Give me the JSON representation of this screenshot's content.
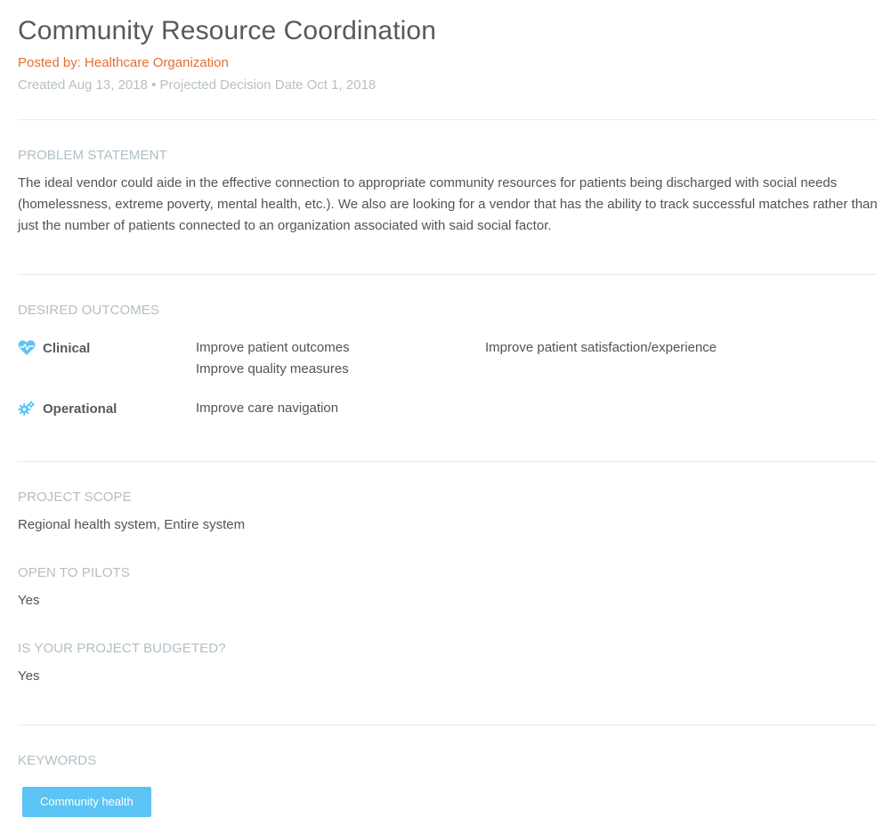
{
  "header": {
    "title": "Community Resource Coordination",
    "posted_by_prefix": "Posted by: ",
    "posted_by_org": "Healthcare Organization",
    "meta": "Created Aug 13, 2018 • Projected Decision Date Oct 1, 2018"
  },
  "problem_statement": {
    "label": "PROBLEM STATEMENT",
    "text": "The ideal vendor could aide in the effective connection to appropriate community resources for patients being discharged with social needs (homelessness, extreme poverty, mental health, etc.). We also are looking for a vendor that has the ability to track successful matches rather than just the number of patients connected to an organization associated with said social factor."
  },
  "desired_outcomes": {
    "label": "DESIRED OUTCOMES",
    "categories": [
      {
        "name": "Clinical",
        "icon": "heart-pulse-icon",
        "items": [
          "Improve patient outcomes",
          "Improve quality measures",
          "Improve patient satisfaction/experience"
        ]
      },
      {
        "name": "Operational",
        "icon": "gears-icon",
        "items": [
          "Improve care navigation"
        ]
      }
    ]
  },
  "project_scope": {
    "label": "PROJECT SCOPE",
    "value": "Regional health system, Entire system"
  },
  "open_to_pilots": {
    "label": "OPEN TO PILOTS",
    "value": "Yes"
  },
  "budgeted": {
    "label": "IS YOUR PROJECT BUDGETED?",
    "value": "Yes"
  },
  "keywords": {
    "label": "KEYWORDS",
    "tags": [
      "Community health"
    ]
  },
  "colors": {
    "accent_orange": "#e46f33",
    "icon_blue": "#5bc4f5",
    "tag_blue": "#5bc4f5",
    "muted_label": "#b2bec5"
  }
}
